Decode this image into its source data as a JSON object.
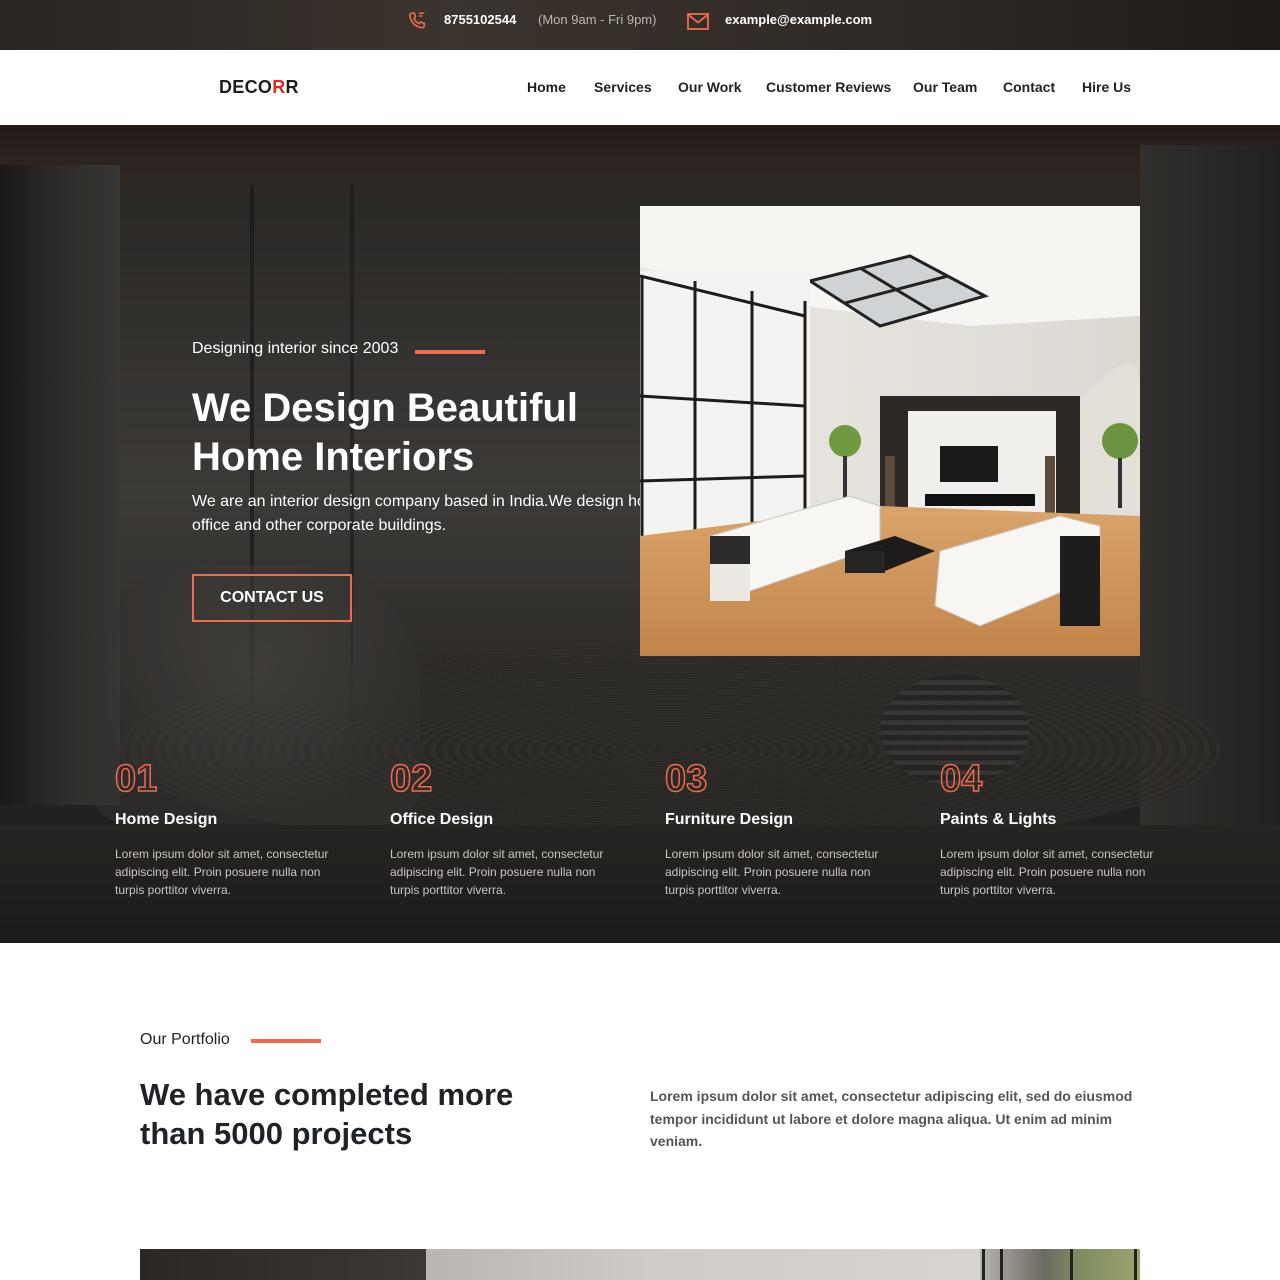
{
  "topbar": {
    "phone": "8755102544",
    "hours": "(Mon 9am - Fri 9pm)",
    "email": "example@example.com",
    "icons": [
      "phone-icon",
      "mail-icon"
    ]
  },
  "navbar": {
    "logo_main": "DECO",
    "logo_accent": "R",
    "logo_end": "R",
    "items": [
      "Home",
      "Services",
      "Our Work",
      "Customer Reviews",
      "Our Team",
      "Contact",
      "Hire Us"
    ]
  },
  "hero": {
    "tagline": "Designing interior since 2003",
    "title": "We Design Beautiful Home Interiors",
    "description": "We are an interior design company based in India.We design home office and other corporate buildings.",
    "description_line1": "We are an interior design company based in India.We design hom",
    "description_line2": "office and other corporate buildings.",
    "cta": "CONTACT US"
  },
  "services": [
    {
      "num": "01",
      "title": "Home Design",
      "text": "Lorem ipsum dolor sit amet, consectetur adipiscing elit. Proin posuere nulla non turpis porttitor viverra."
    },
    {
      "num": "02",
      "title": "Office Design",
      "text": "Lorem ipsum dolor sit amet, consectetur adipiscing elit. Proin posuere nulla non turpis porttitor viverra."
    },
    {
      "num": "03",
      "title": "Furniture Design",
      "text": "Lorem ipsum dolor sit amet, consectetur adipiscing elit. Proin posuere nulla non turpis porttitor viverra."
    },
    {
      "num": "04",
      "title": "Paints & Lights",
      "text": "Lorem ipsum dolor sit amet, consectetur adipiscing elit. Proin posuere nulla non turpis porttitor viverra."
    }
  ],
  "portfolio": {
    "label": "Our Portfolio",
    "title": "We have completed more than 5000 projects",
    "text": "Lorem ipsum dolor sit amet, consectetur adipiscing elit, sed do eiusmod tempor incididunt ut labore et dolore magna aliqua. Ut enim ad minim veniam."
  },
  "colors": {
    "accent": "#ee6b4f",
    "logo_accent": "#e8261f",
    "topbar_bg": "#2f2925"
  }
}
